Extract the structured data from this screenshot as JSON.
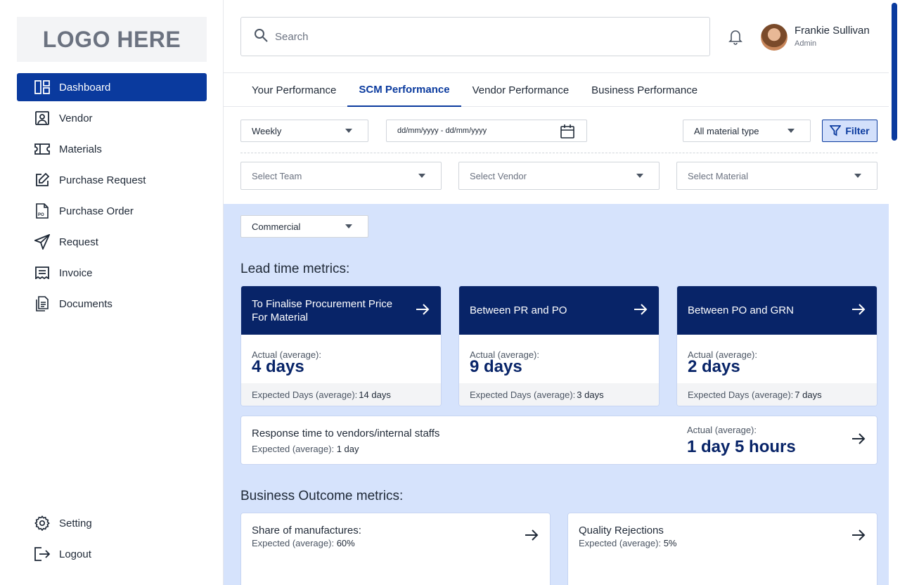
{
  "logo": {
    "text": "LOGO HERE"
  },
  "sidebar": {
    "items": [
      {
        "label": "Dashboard",
        "icon": "dashboard-icon",
        "active": true
      },
      {
        "label": "Vendor",
        "icon": "vendor-icon"
      },
      {
        "label": "Materials",
        "icon": "ticket-icon"
      },
      {
        "label": "Purchase Request",
        "icon": "edit-icon"
      },
      {
        "label": "Purchase Order",
        "icon": "po-document-icon"
      },
      {
        "label": "Request",
        "icon": "send-icon"
      },
      {
        "label": "Invoice",
        "icon": "invoice-icon"
      },
      {
        "label": "Documents",
        "icon": "documents-icon"
      }
    ],
    "bottom": [
      {
        "label": "Setting",
        "icon": "gear-icon"
      },
      {
        "label": "Logout",
        "icon": "logout-icon"
      }
    ]
  },
  "header": {
    "search_placeholder": "Search",
    "user_name": "Frankie Sullivan",
    "user_role": "Admin"
  },
  "tabs": [
    {
      "label": "Your Performance"
    },
    {
      "label": "SCM Performance",
      "active": true
    },
    {
      "label": "Vendor Performance"
    },
    {
      "label": "Business Performance"
    }
  ],
  "filters": {
    "period": "Weekly",
    "date_range": "dd/mm/yyyy - dd/mm/yyyy",
    "material_type": "All material type",
    "filter_label": "Filter",
    "team": "Select Team",
    "vendor": "Select Vendor",
    "material": "Select Material",
    "segment": "Commercial"
  },
  "lead_time": {
    "title": "Lead time metrics:",
    "cards": [
      {
        "title": "To Finalise Procurement Price For Material",
        "actual_label": "Actual (average):",
        "actual": "4 days",
        "expected_label": "Expected  Days (average):",
        "expected": "14 days"
      },
      {
        "title": "Between PR and PO",
        "actual_label": "Actual (average):",
        "actual": "9 days",
        "expected_label": "Expected  Days (average):",
        "expected": "3 days"
      },
      {
        "title": "Between PO and GRN",
        "actual_label": "Actual (average):",
        "actual": "2 days",
        "expected_label": "Expected  Days (average):",
        "expected": "7 days"
      }
    ],
    "response": {
      "title": "Response time to vendors/internal staffs",
      "expected_label": "Expected (average):",
      "expected": "1 day",
      "actual_label": "Actual (average):",
      "actual": "1 day 5 hours"
    }
  },
  "business_outcome": {
    "title": "Business Outcome metrics:",
    "cards": [
      {
        "title": "Share of manufactures:",
        "expected_label": "Expected (average):",
        "expected": "60%"
      },
      {
        "title": "Quality Rejections",
        "expected_label": "Expected (average):",
        "expected": "5%"
      }
    ]
  },
  "colors": {
    "primary": "#0a3a9e",
    "navy": "#082468",
    "content_bg": "#d6e3fc"
  }
}
